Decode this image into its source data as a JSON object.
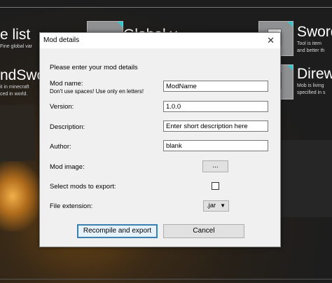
{
  "background": {
    "items": [
      {
        "title": "e list",
        "sub": "Fine global var"
      },
      {
        "title": "ndSwo",
        "sub": "it in minecraft\nced in world."
      },
      {
        "title": "Sword",
        "sub": "Tool is item\nand better th"
      },
      {
        "title": "Direw",
        "sub": "Mob is living\nspecified in s"
      },
      {
        "title": "Global v",
        "sub": ""
      }
    ]
  },
  "dialog": {
    "title": "Mod details",
    "close_glyph": "✕",
    "intro": "Please enter your mod details",
    "mod_name": {
      "label": "Mod name:",
      "hint": "Don't use spaces! Use only en letters!",
      "value": "ModName"
    },
    "version": {
      "label": "Version:",
      "value": "1.0.0"
    },
    "description": {
      "label": "Description:",
      "value": "Enter short description here"
    },
    "author": {
      "label": "Author:",
      "value": "blank"
    },
    "mod_image": {
      "label": "Mod image:",
      "button": "..."
    },
    "select_mods": {
      "label": "Select mods to export:",
      "checked": false
    },
    "file_extension": {
      "label": "File extension:",
      "value": ".jar"
    },
    "recompile_button": "Recompile and export",
    "cancel_button": "Cancel"
  }
}
